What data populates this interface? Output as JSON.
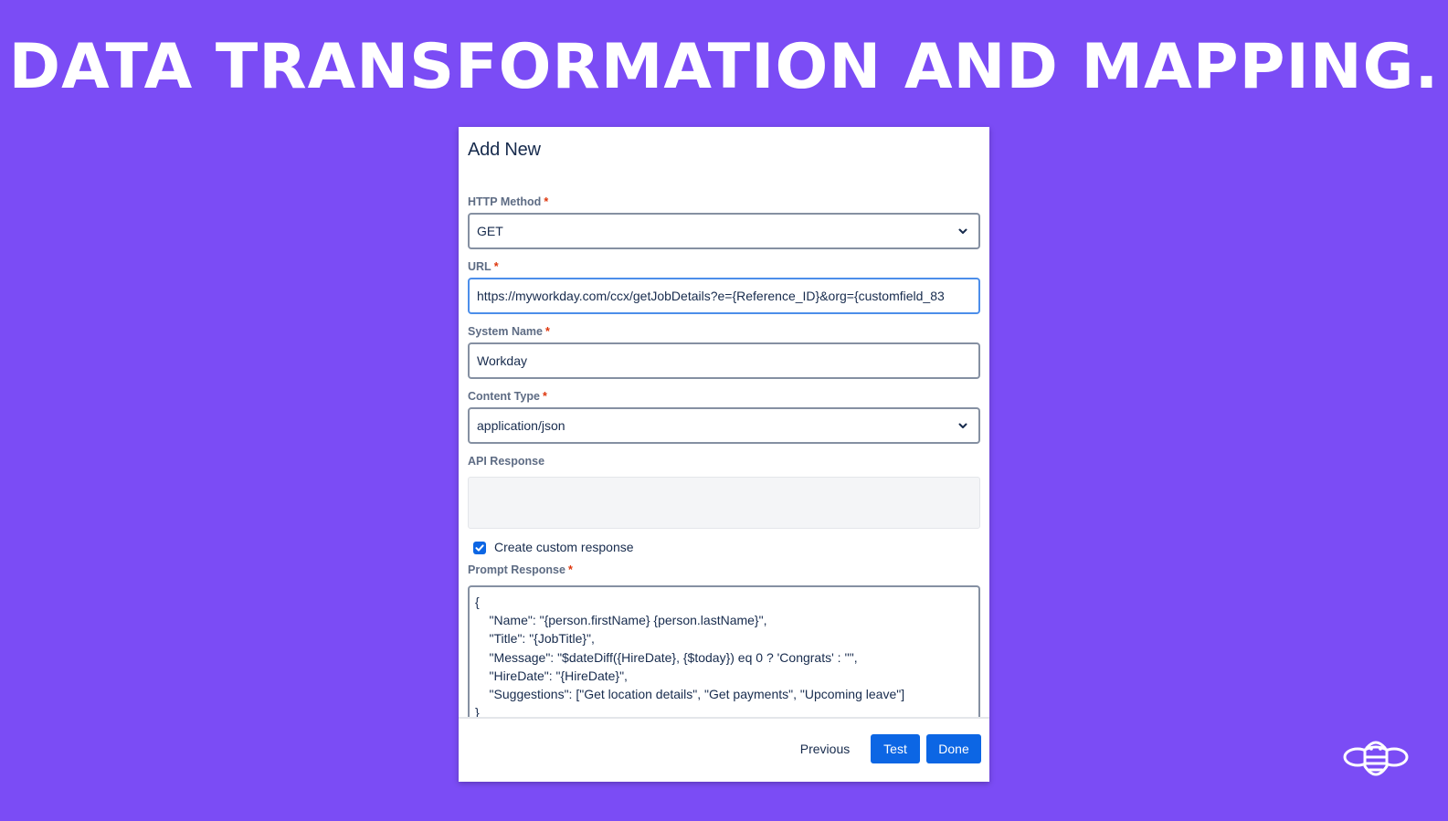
{
  "headline": "DATA TRANSFORMATION AND MAPPING.",
  "dialog": {
    "title": "Add New",
    "required_marker": "*",
    "http_method": {
      "label": "HTTP Method",
      "value": "GET",
      "icon": "chevron-down-icon"
    },
    "url": {
      "label": "URL",
      "value": "https://myworkday.com/ccx/getJobDetails?e={Reference_ID}&org={customfield_83"
    },
    "system_name": {
      "label": "System Name",
      "value": "Workday"
    },
    "content_type": {
      "label": "Content Type",
      "value": "application/json",
      "icon": "chevron-down-icon"
    },
    "api_response": {
      "label": "API Response",
      "value": ""
    },
    "custom_response": {
      "label": "Create custom response",
      "checked": true
    },
    "prompt_response": {
      "label": "Prompt Response",
      "lines": [
        "{",
        "    \"Name\": \"{person.firstName} {person.lastName}\",",
        "    \"Title\": \"{JobTitle}\",",
        "    \"Message\": \"$dateDiff({HireDate}, {$today}) eq 0 ? 'Congrats' : ''\",",
        "    \"HireDate\": \"{HireDate}\",",
        "    \"Suggestions\": [\"Get location details\", \"Get payments\", \"Upcoming leave\"]",
        "}"
      ]
    },
    "buttons": {
      "previous": "Previous",
      "test": "Test",
      "done": "Done"
    }
  },
  "colors": {
    "background": "#7b4cf5",
    "primary": "#0c66e4",
    "required": "#de350b",
    "focus_border": "#4c8eea"
  },
  "logo": {
    "icon": "bee-logo-icon"
  }
}
